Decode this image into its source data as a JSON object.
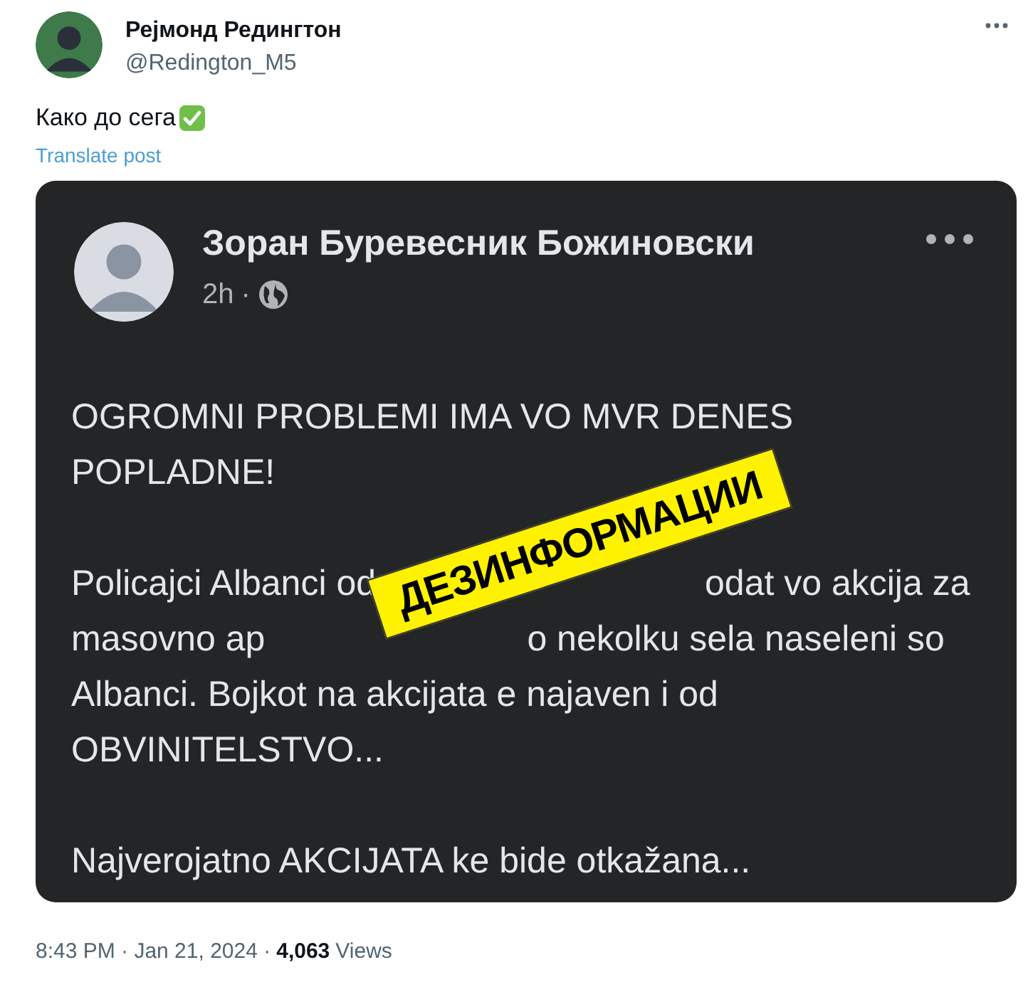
{
  "tweet": {
    "author_name": "Рејмонд Редингтон",
    "handle": "@Redington_M5",
    "text": "Како до сега",
    "translate_link": "Translate post",
    "embedded_post": {
      "author_name": "Зоран Буревесник Божиновски",
      "time": "2h",
      "separator": "·",
      "paragraphs": [
        {
          "lines": [
            [
              "OGROMNI PROBLEMI IMA VO MVR DENES"
            ],
            [
              "POPLADNE!"
            ]
          ]
        },
        {
          "lines": [
            [
              "Policajci Albanci od",
              "odat vo akcija za"
            ],
            [
              "masovno ap",
              "o nekolku sela naseleni so"
            ],
            [
              "Albanci. Bojkot na akcijata e najaven i od"
            ],
            [
              "OBVINITELSTVO..."
            ]
          ]
        },
        {
          "lines": [
            [
              "Najverojatno AKCIJATA ke bide otkažana..."
            ]
          ]
        }
      ],
      "stamp": "ДЕЗИНФОРМАЦИИ"
    },
    "meta": "8:43 PM · Jan 21, 2024 ·",
    "views_count": "4,063",
    "views_label": "Views"
  }
}
